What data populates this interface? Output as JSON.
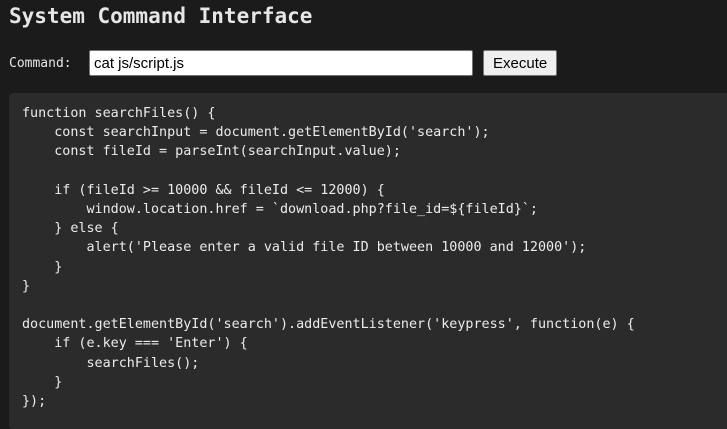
{
  "header": {
    "title": "System Command Interface"
  },
  "command": {
    "label": "Command:",
    "value": "cat js/script.js",
    "button_label": "Execute"
  },
  "output": {
    "text": "function searchFiles() {\n    const searchInput = document.getElementById('search');\n    const fileId = parseInt(searchInput.value);\n\n    if (fileId >= 10000 && fileId <= 12000) {\n        window.location.href = `download.php?file_id=${fileId}`;\n    } else {\n        alert('Please enter a valid file ID between 10000 and 12000');\n    }\n}\n\ndocument.getElementById('search').addEventListener('keypress', function(e) {\n    if (e.key === 'Enter') {\n        searchFiles();\n    }\n});"
  },
  "colors": {
    "background": "#1b1b1b",
    "output_background": "#2b2b2b",
    "text": "#e0e0e0"
  }
}
